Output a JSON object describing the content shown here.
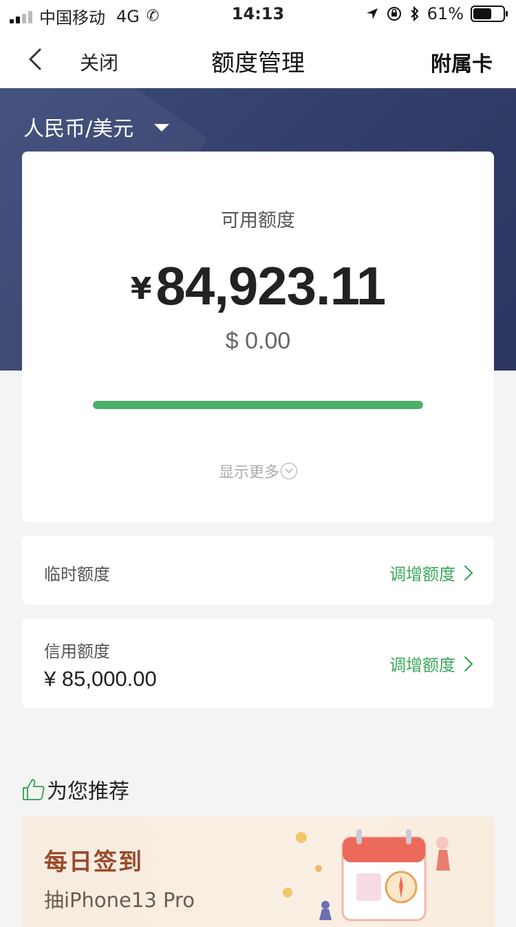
{
  "status_bar": {
    "carrier": "中国移动",
    "network": "4G",
    "time": "14:13",
    "battery_percent": "61%",
    "battery_level": 0.61
  },
  "nav": {
    "close_label": "关闭",
    "title": "额度管理",
    "right_label": "附属卡"
  },
  "currency_selector": {
    "label": "人民币/美元"
  },
  "available": {
    "label": "可用额度",
    "cny_symbol": "¥",
    "cny_amount": "84,923.11",
    "usd_amount": "$ 0.00",
    "usage_fraction": 1.0,
    "show_more_label": "显示更多"
  },
  "temp_limit": {
    "title": "临时额度",
    "action_label": "调增额度"
  },
  "credit_limit": {
    "title": "信用额度",
    "value": "¥ 85,000.00",
    "action_label": "调增额度"
  },
  "recommend": {
    "section_title": "为您推荐",
    "banner_title": "每日签到",
    "banner_subtitle": "抽iPhone13 Pro"
  },
  "colors": {
    "accent_green": "#3da85b",
    "hero_navy": "#323d69",
    "banner_brown": "#9b4a2c"
  }
}
